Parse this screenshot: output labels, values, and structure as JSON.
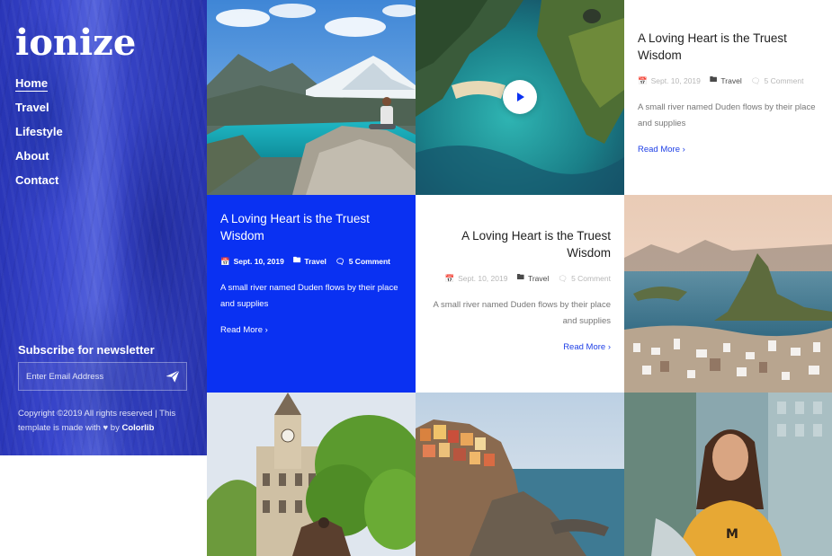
{
  "brand": {
    "logo": "ionize"
  },
  "nav": {
    "items": [
      {
        "label": "Home",
        "active": true
      },
      {
        "label": "Travel",
        "active": false
      },
      {
        "label": "Lifestyle",
        "active": false
      },
      {
        "label": "About",
        "active": false
      },
      {
        "label": "Contact",
        "active": false
      }
    ]
  },
  "newsletter": {
    "title": "Subscribe for newsletter",
    "placeholder": "Enter Email Address",
    "submit_icon": "paper-plane-icon"
  },
  "footer": {
    "copyright_prefix": "Copyright ©2019 All rights reserved | This template is made with",
    "heart_icon": "heart-icon",
    "by": "by",
    "credit": "Colorlib"
  },
  "posts": [
    {
      "title": "A Loving Heart is the Truest Wisdom",
      "date": "Sept. 10, 2019",
      "category": "Travel",
      "comments": "5 Comment",
      "excerpt": "A small river named Duden flows by their place and supplies",
      "read_more": "Read More"
    },
    {
      "title": "A Loving Heart is the Truest Wisdom",
      "date": "Sept. 10, 2019",
      "category": "Travel",
      "comments": "5 Comment",
      "excerpt": "A small river named Duden flows by their place and supplies",
      "read_more": "Read More"
    },
    {
      "title": "A Loving Heart is the Truest Wisdom",
      "date": "Sept. 10, 2019",
      "category": "Travel",
      "comments": "5 Comment",
      "excerpt": "A small river named Duden flows by their place and supplies",
      "read_more": "Read More"
    }
  ],
  "colors": {
    "accent": "#0a31f2",
    "sidebar": "#3542c4",
    "link": "#1e3fe6"
  }
}
